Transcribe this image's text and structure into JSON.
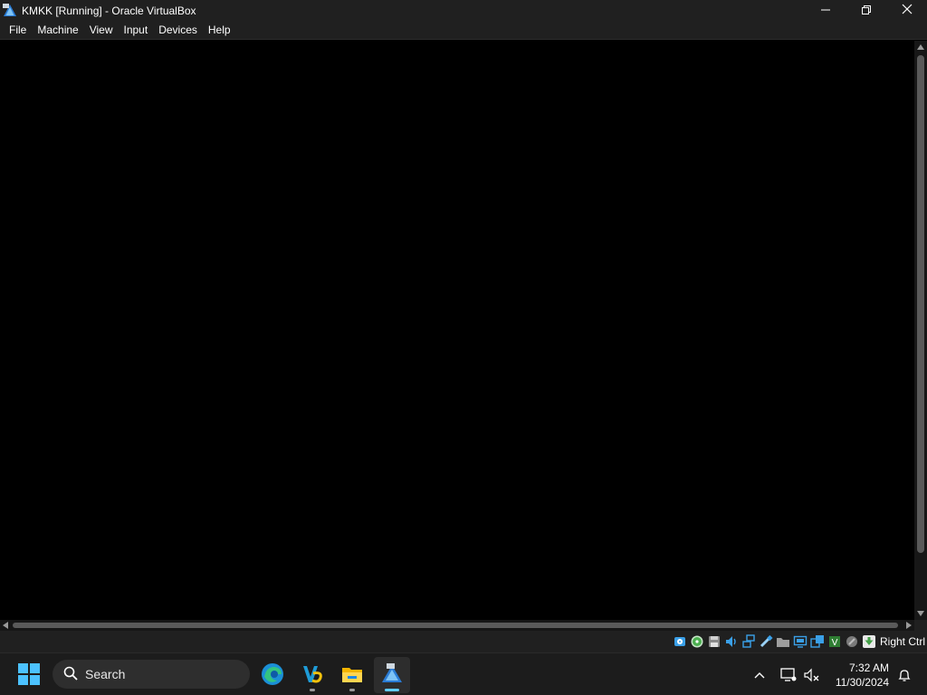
{
  "window": {
    "title": "KMKK [Running] - Oracle VirtualBox",
    "icon": "virtualbox-icon"
  },
  "window_controls": {
    "minimize_icon": "minimize-icon",
    "maximize_icon": "restore-icon",
    "close_icon": "close-icon"
  },
  "menu": {
    "items": [
      {
        "label": "File"
      },
      {
        "label": "Machine"
      },
      {
        "label": "View"
      },
      {
        "label": "Input"
      },
      {
        "label": "Devices"
      },
      {
        "label": "Help"
      }
    ]
  },
  "statusbar": {
    "icons": [
      "hard-disk-icon",
      "optical-drive-icon",
      "floppy-icon",
      "audio-icon",
      "network-icon",
      "usb-icon",
      "shared-folders-icon",
      "display-icon",
      "recording-icon",
      "cpu-icon",
      "mouse-integration-icon",
      "host-key-icon"
    ],
    "host_key": "Right Ctrl"
  },
  "taskbar": {
    "search_placeholder": "Search",
    "apps": [
      "edge-icon",
      "visual-studio-icon",
      "file-explorer-icon",
      "virtualbox-icon"
    ],
    "active_app": "virtualbox-icon"
  },
  "tray": {
    "time": "7:32 AM",
    "date": "11/30/2024"
  },
  "colors": {
    "titlebar": "#202020",
    "taskbar": "#1c1c1c",
    "accent": "#60cdff"
  }
}
